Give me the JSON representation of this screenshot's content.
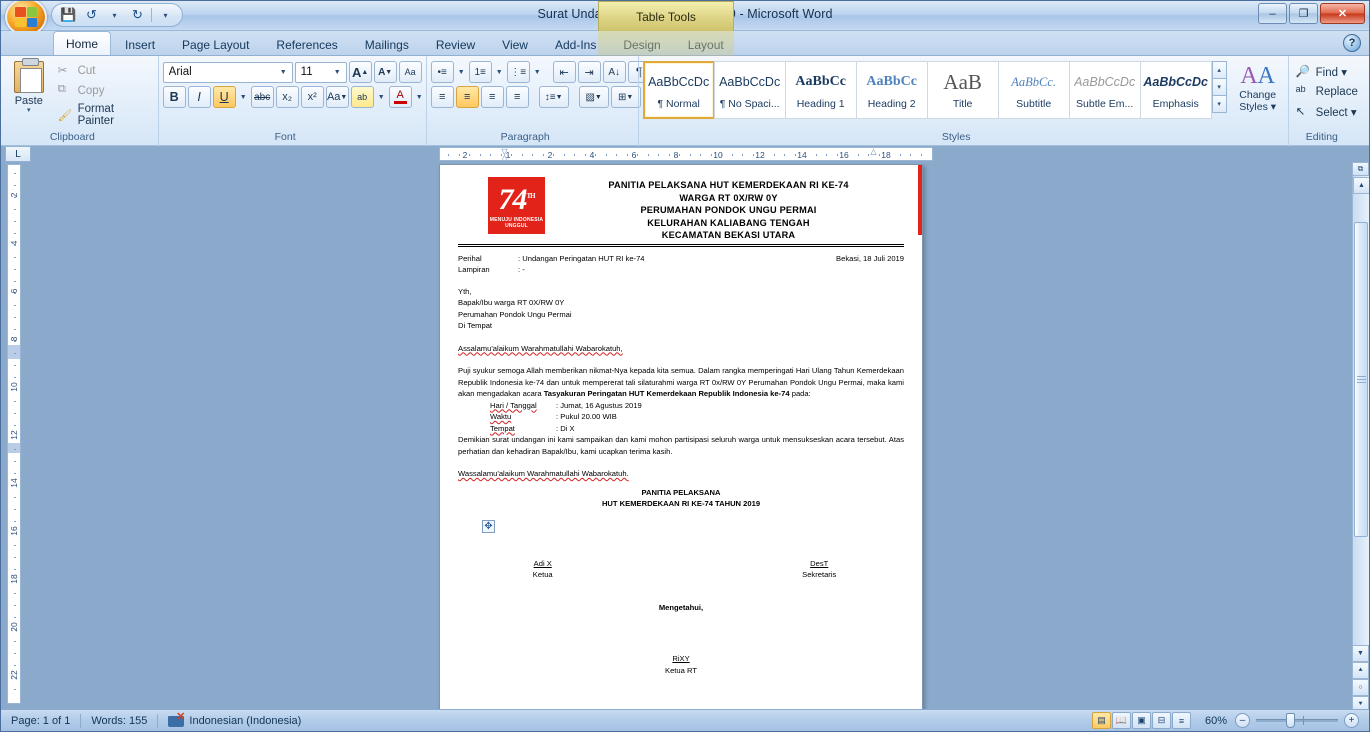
{
  "window": {
    "title": "Surat Undangan 17 Agutusan 2019 - Microsoft Word",
    "contextual_tab_title": "Table Tools",
    "minimize": "–",
    "restore": "❐",
    "close": "✕",
    "help": "?"
  },
  "quick_access": {
    "save": "💾",
    "undo": "↺",
    "undo_arrow": "▾",
    "redo": "↻",
    "customize": "▾"
  },
  "tabs": [
    {
      "label": "Home",
      "active": true
    },
    {
      "label": "Insert",
      "active": false
    },
    {
      "label": "Page Layout",
      "active": false
    },
    {
      "label": "References",
      "active": false
    },
    {
      "label": "Mailings",
      "active": false
    },
    {
      "label": "Review",
      "active": false
    },
    {
      "label": "View",
      "active": false
    },
    {
      "label": "Add-Ins",
      "active": false
    },
    {
      "label": "Design",
      "active": false,
      "contextual": true
    },
    {
      "label": "Layout",
      "active": false,
      "contextual": true
    }
  ],
  "ribbon": {
    "clipboard": {
      "label": "Clipboard",
      "paste": "Paste",
      "paste_arrow": "▾",
      "cut": "Cut",
      "copy": "Copy",
      "format_painter": "Format Painter",
      "launcher": "↘"
    },
    "font": {
      "label": "Font",
      "font_name": "Arial",
      "font_size": "11",
      "grow_font": "A",
      "shrink_font": "A",
      "clear_formatting": "Aa",
      "bold": "B",
      "italic": "I",
      "underline": "U",
      "strikethrough": "abc",
      "subscript": "x₂",
      "superscript": "x²",
      "change_case": "Aa",
      "highlight": "ab",
      "font_color": "A",
      "launcher": "↘"
    },
    "paragraph": {
      "label": "Paragraph",
      "bullets": "•≡",
      "numbering": "1≡",
      "multilevel": "⋮≡",
      "decrease_indent": "⇤",
      "increase_indent": "⇥",
      "sort": "A↓",
      "show_marks": "¶",
      "align_left": "≡",
      "align_center": "≡",
      "align_right": "≡",
      "justify": "≡",
      "line_spacing": "↕≡",
      "shading": "▧",
      "borders": "⊞",
      "launcher": "↘"
    },
    "styles": {
      "label": "Styles",
      "items": [
        {
          "preview": "AaBbCcDc",
          "name": "¶ Normal",
          "selected": true
        },
        {
          "preview": "AaBbCcDc",
          "name": "¶ No Spaci...",
          "selected": false
        },
        {
          "preview": "AaBbCс",
          "name": "Heading 1",
          "selected": false
        },
        {
          "preview": "AaBbCc",
          "name": "Heading 2",
          "selected": false
        },
        {
          "preview": "AaB",
          "name": "Title",
          "selected": false
        },
        {
          "preview": "AaBbCc.",
          "name": "Subtitle",
          "selected": false
        },
        {
          "preview": "AaBbCcDc",
          "name": "Subtle Em...",
          "selected": false
        },
        {
          "preview": "AaBbCcDc",
          "name": "Emphasis",
          "selected": false
        }
      ],
      "scroll_up": "▴",
      "scroll_down": "▾",
      "more": "▾",
      "change_styles": "Change",
      "change_styles2": "Styles ▾",
      "launcher": "↘"
    },
    "editing": {
      "label": "Editing",
      "find": "Find ▾",
      "replace": "Replace",
      "select": "Select ▾"
    }
  },
  "ruler": {
    "tab_selector": "L",
    "horizontal_numbers": [
      "2",
      "1",
      "2",
      "4",
      "6",
      "8",
      "10",
      "12",
      "14",
      "16",
      "18"
    ],
    "vertical_numbers": [
      "2",
      "4",
      "6",
      "8",
      "10",
      "12",
      "14",
      "16",
      "18",
      "20",
      "22"
    ]
  },
  "document": {
    "logo": {
      "number": "74",
      "th": "TH",
      "tagline": "MENUJU INDONESIA UNGGUL"
    },
    "header_lines": [
      "PANITIA PELAKSANA  HUT KEMERDEKAAN  RI KE-74",
      "WARGA RT 0X/RW 0Y",
      "PERUMAHAN PONDOK UNGU PERMAI",
      "KELURAHAN KALIABANG TENGAH",
      "KECAMATAN BEKASI UTARA"
    ],
    "meta": [
      {
        "key": "Perihal",
        "colon": ":",
        "value": "Undangan Peringatan HUT RI ke-74",
        "right": "Bekasi, 18 Juli 2019"
      },
      {
        "key": "Lampiran",
        "colon": ":",
        "value": "-",
        "right": ""
      }
    ],
    "addressee": [
      "Yth,",
      "Bapak/Ibu warga RT 0X/RW 0Y",
      "Perumahan Pondok Ungu Permai",
      "Di Tempat"
    ],
    "salam": "Assalamu'alaikum Warahmatullahi Wabarokatuh,",
    "body_p1_a": "Puji syukur semoga Allah memberikan nikmat-Nya kepada kita semua. Dalam rangka memperingati Hari Ulang Tahun Kemerdekaan Republik Indonesia ke-74 dan untuk mempererat tali silaturahmi warga RT 0x/RW 0Y Perumahan Pondok Ungu Permai, maka kami akan mengadakan acara ",
    "body_p1_bold": "Tasyakuran Peringatan HUT Kemerdekaan Republik Indonesia ke-74",
    "body_p1_c": " pada:",
    "details": [
      {
        "key": "Hari / Tanggal",
        "colon": ":",
        "value": "Jumat, 16 Agustus 2019"
      },
      {
        "key": "Waktu",
        "colon": ":",
        "value": "Pukul 20.00 WIB"
      },
      {
        "key": "Tempat",
        "colon": ":",
        "value": "Di X"
      }
    ],
    "body_p2": "Demikian surat undangan ini kami sampaikan dan kami mohon partisipasi seluruh warga untuk mensukseskan acara tersebut. Atas perhatian dan kehadiran Bapak/Ibu, kami ucapkan terima kasih.",
    "penutup": "Wassalamu'alaikum Warahmatullahi Wabarokatuh.",
    "committee": [
      "PANITIA PELAKSANA",
      "HUT KEMERDEKAAN RI KE-74 TAHUN 2019"
    ],
    "signatories": [
      {
        "name": "Adi X",
        "role": "Ketua"
      },
      {
        "name": "DesT",
        "role": "Sekretaris"
      }
    ],
    "mengetahui": "Mengetahui,",
    "final_signatory": {
      "name": "RiXY",
      "role": "Ketua RT"
    },
    "table_handle": "✥"
  },
  "status_bar": {
    "page": "Page: 1 of 1",
    "words": "Words: 155",
    "language": "Indonesian (Indonesia)",
    "views": [
      {
        "icon": "▤",
        "name": "print-layout",
        "active": true
      },
      {
        "icon": "📖",
        "name": "full-screen-reading",
        "active": false
      },
      {
        "icon": "▣",
        "name": "web-layout",
        "active": false
      },
      {
        "icon": "⊟",
        "name": "outline",
        "active": false
      },
      {
        "icon": "≡",
        "name": "draft",
        "active": false
      }
    ],
    "zoom": "60%",
    "zoom_out": "–",
    "zoom_in": "+"
  },
  "colors": {
    "accent_red": "#e2231a",
    "ribbon_blue": "#cfe0f3",
    "highlight_orange": "#ffc75e"
  }
}
